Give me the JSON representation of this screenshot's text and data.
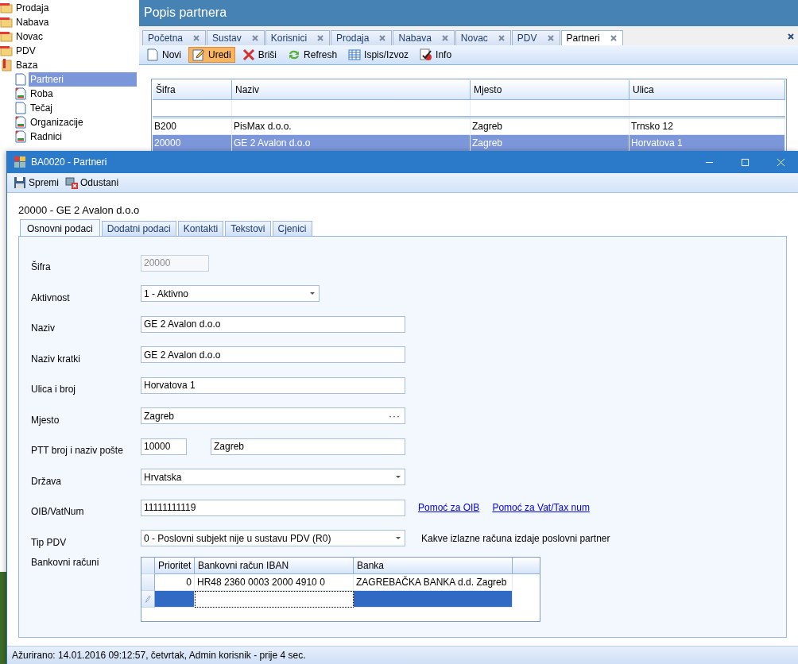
{
  "sidebar": {
    "items": [
      {
        "label": "Prodaja",
        "kind": "folder"
      },
      {
        "label": "Nabava",
        "kind": "folder"
      },
      {
        "label": "Novac",
        "kind": "folder"
      },
      {
        "label": "PDV",
        "kind": "folder"
      },
      {
        "label": "Baza",
        "kind": "book",
        "children": [
          {
            "label": "Partneri",
            "kind": "page",
            "selected": true
          },
          {
            "label": "Roba",
            "kind": "report",
            "selected": false
          },
          {
            "label": "Tečaj",
            "kind": "page",
            "selected": false
          },
          {
            "label": "Organizacije",
            "kind": "report",
            "selected": false
          },
          {
            "label": "Radnici",
            "kind": "report",
            "selected": false
          }
        ]
      }
    ]
  },
  "main": {
    "title": "Popis partnera",
    "tabs": [
      {
        "label": "Početna",
        "selected": false
      },
      {
        "label": "Sustav",
        "selected": false
      },
      {
        "label": "Korisnici",
        "selected": false
      },
      {
        "label": "Prodaja",
        "selected": false
      },
      {
        "label": "Nabava",
        "selected": false
      },
      {
        "label": "Novac",
        "selected": false
      },
      {
        "label": "PDV",
        "selected": false
      },
      {
        "label": "Partneri",
        "selected": true
      }
    ],
    "toolbar": [
      {
        "label": "Novi",
        "kind": "new",
        "selected": false
      },
      {
        "label": "Uredi",
        "kind": "edit",
        "selected": true
      },
      {
        "label": "Briši",
        "kind": "delete",
        "selected": false
      },
      {
        "label": "Refresh",
        "kind": "refresh",
        "selected": false
      },
      {
        "label": "Ispis/Izvoz",
        "kind": "table",
        "selected": false
      },
      {
        "label": "Info",
        "kind": "info",
        "selected": false
      }
    ],
    "table": {
      "columns": [
        "Šifra",
        "Naziv",
        "Mjesto",
        "Ulica"
      ],
      "rows": [
        {
          "cells": [
            "B200",
            "PisMax d.o.o.",
            "Zagreb",
            "Trnsko 12"
          ],
          "selected": false
        },
        {
          "cells": [
            "20000",
            "GE 2 Avalon d.o.o",
            "Zagreb",
            "Horvatova 1"
          ],
          "selected": true
        }
      ]
    }
  },
  "dialog": {
    "title": "BA0020 - Partneri",
    "toolbar": [
      {
        "label": "Spremi",
        "kind": "save"
      },
      {
        "label": "Odustani",
        "kind": "cancel"
      }
    ],
    "heading": "20000 - GE 2 Avalon d.o.o",
    "tabs": [
      {
        "label": "Osnovni podaci",
        "selected": true
      },
      {
        "label": "Dodatni podaci",
        "selected": false
      },
      {
        "label": "Kontakti",
        "selected": false
      },
      {
        "label": "Tekstovi",
        "selected": false
      },
      {
        "label": "Cjenici",
        "selected": false
      }
    ],
    "fields": [
      {
        "label": "Šifra",
        "kind": "text",
        "value": "20000",
        "disabled": true
      },
      {
        "label": "Aktivnost",
        "kind": "dropdown",
        "value": "1 - Aktivno"
      },
      {
        "label": "Naziv",
        "kind": "text",
        "value": "GE 2 Avalon d.o.o",
        "disabled": false
      },
      {
        "label": "Naziv kratki",
        "kind": "text",
        "value": "GE 2 Avalon d.o.o",
        "disabled": false
      },
      {
        "label": "Ulica i broj",
        "kind": "text",
        "value": "Horvatova 1",
        "disabled": false
      },
      {
        "label": "Mjesto",
        "kind": "lookup",
        "value": "Zagreb",
        "button": "···"
      },
      {
        "label": "PTT broj i naziv pošte",
        "kind": "pair",
        "value": "10000",
        "value_2": "Zagreb"
      },
      {
        "label": "Država",
        "kind": "dropdown",
        "value": "Hrvatska"
      },
      {
        "label": "OIB/VatNum",
        "kind": "text",
        "value": "11111111119",
        "disabled": false,
        "links": [
          "Pomoć za OIB",
          "Pomoć za Vat/Tax num"
        ]
      },
      {
        "label": "Tip PDV",
        "kind": "dropdown",
        "value": "0 - Poslovni subjekt nije u sustavu PDV (R0)",
        "hint": "Kakve izlazne računa izdaje poslovni partner"
      }
    ],
    "bank_accounts": {
      "label": "Bankovni računi",
      "columns": [
        "Prioritet",
        "Bankovni račun IBAN",
        "Banka"
      ],
      "rows": [
        {
          "cells": [
            "0",
            "HR48 2360 0003 2000 4910 0",
            "ZAGREBAČKA BANKA d.d. Zagreb"
          ]
        }
      ],
      "new_row_selected": true
    },
    "status_bar": "Ažurirano: 14.01.2016 09:12:57, četvrtak, Admin korisnik -  prije 4 sec."
  }
}
